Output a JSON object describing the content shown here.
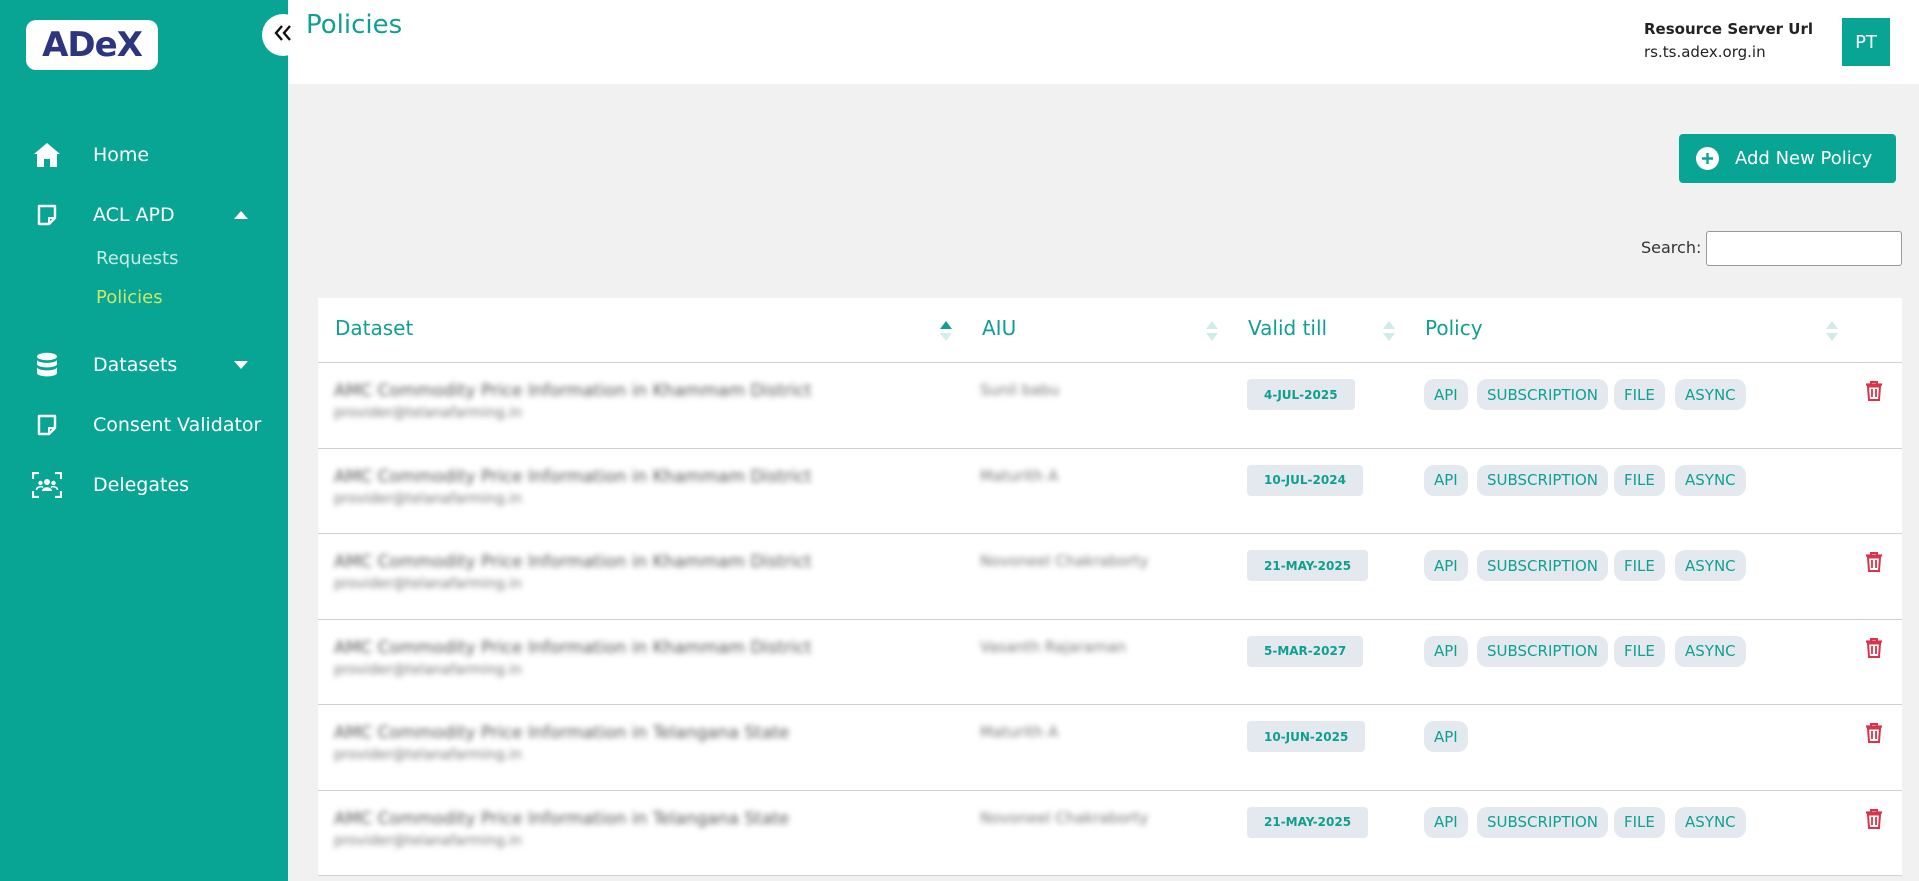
{
  "brand": {
    "logo_text": "ADeX"
  },
  "colors": {
    "primary": "#08a595",
    "accent": "#c9e86a",
    "danger": "#d9344a"
  },
  "sidebar": {
    "items": [
      {
        "label": "Home",
        "icon": "home-icon"
      },
      {
        "label": "ACL APD",
        "icon": "note-icon"
      },
      {
        "label": "Datasets",
        "icon": "database-icon"
      },
      {
        "label": "Consent Validator",
        "icon": "note-icon"
      },
      {
        "label": "Delegates",
        "icon": "users-scan-icon"
      }
    ],
    "acl_sub": [
      "Requests",
      "Policies"
    ]
  },
  "header": {
    "title": "Policies",
    "resource_label": "Resource Server Url",
    "resource_url": "rs.ts.adex.org.in",
    "avatar": "PT"
  },
  "actions": {
    "add_label": "Add New Policy",
    "search_label": "Search:"
  },
  "table": {
    "columns": [
      "Dataset",
      "AIU",
      "Valid till",
      "Policy"
    ],
    "rows": [
      {
        "dataset": "AMC Commodity Price Information in Khammam District",
        "provider": "provider@telanafarming.in",
        "aiu": "Sunil babu",
        "valid_till": "4-JUL-2025",
        "policies": [
          "API",
          "SUBSCRIPTION",
          "FILE",
          "ASYNC"
        ],
        "deletable": true
      },
      {
        "dataset": "AMC Commodity Price Information in Khammam District",
        "provider": "provider@telanafarming.in",
        "aiu": "Maturith A",
        "valid_till": "10-JUL-2024",
        "policies": [
          "API",
          "SUBSCRIPTION",
          "FILE",
          "ASYNC"
        ],
        "deletable": false
      },
      {
        "dataset": "AMC Commodity Price Information in Khammam District",
        "provider": "provider@telanafarming.in",
        "aiu": "Novoneel Chakraborty",
        "valid_till": "21-MAY-2025",
        "policies": [
          "API",
          "SUBSCRIPTION",
          "FILE",
          "ASYNC"
        ],
        "deletable": true
      },
      {
        "dataset": "AMC Commodity Price Information in Khammam District",
        "provider": "provider@telanafarming.in",
        "aiu": "Vasanth Rajaraman",
        "valid_till": "5-MAR-2027",
        "policies": [
          "API",
          "SUBSCRIPTION",
          "FILE",
          "ASYNC"
        ],
        "deletable": true
      },
      {
        "dataset": "AMC Commodity Price Information in Telangana State",
        "provider": "provider@telanafarming.in",
        "aiu": "Maturith A",
        "valid_till": "10-JUN-2025",
        "policies": [
          "API"
        ],
        "deletable": true
      },
      {
        "dataset": "AMC Commodity Price Information in Telangana State",
        "provider": "provider@telanafarming.in",
        "aiu": "Novoneel Chakraborty",
        "valid_till": "21-MAY-2025",
        "policies": [
          "API",
          "SUBSCRIPTION",
          "FILE",
          "ASYNC"
        ],
        "deletable": true
      }
    ]
  }
}
